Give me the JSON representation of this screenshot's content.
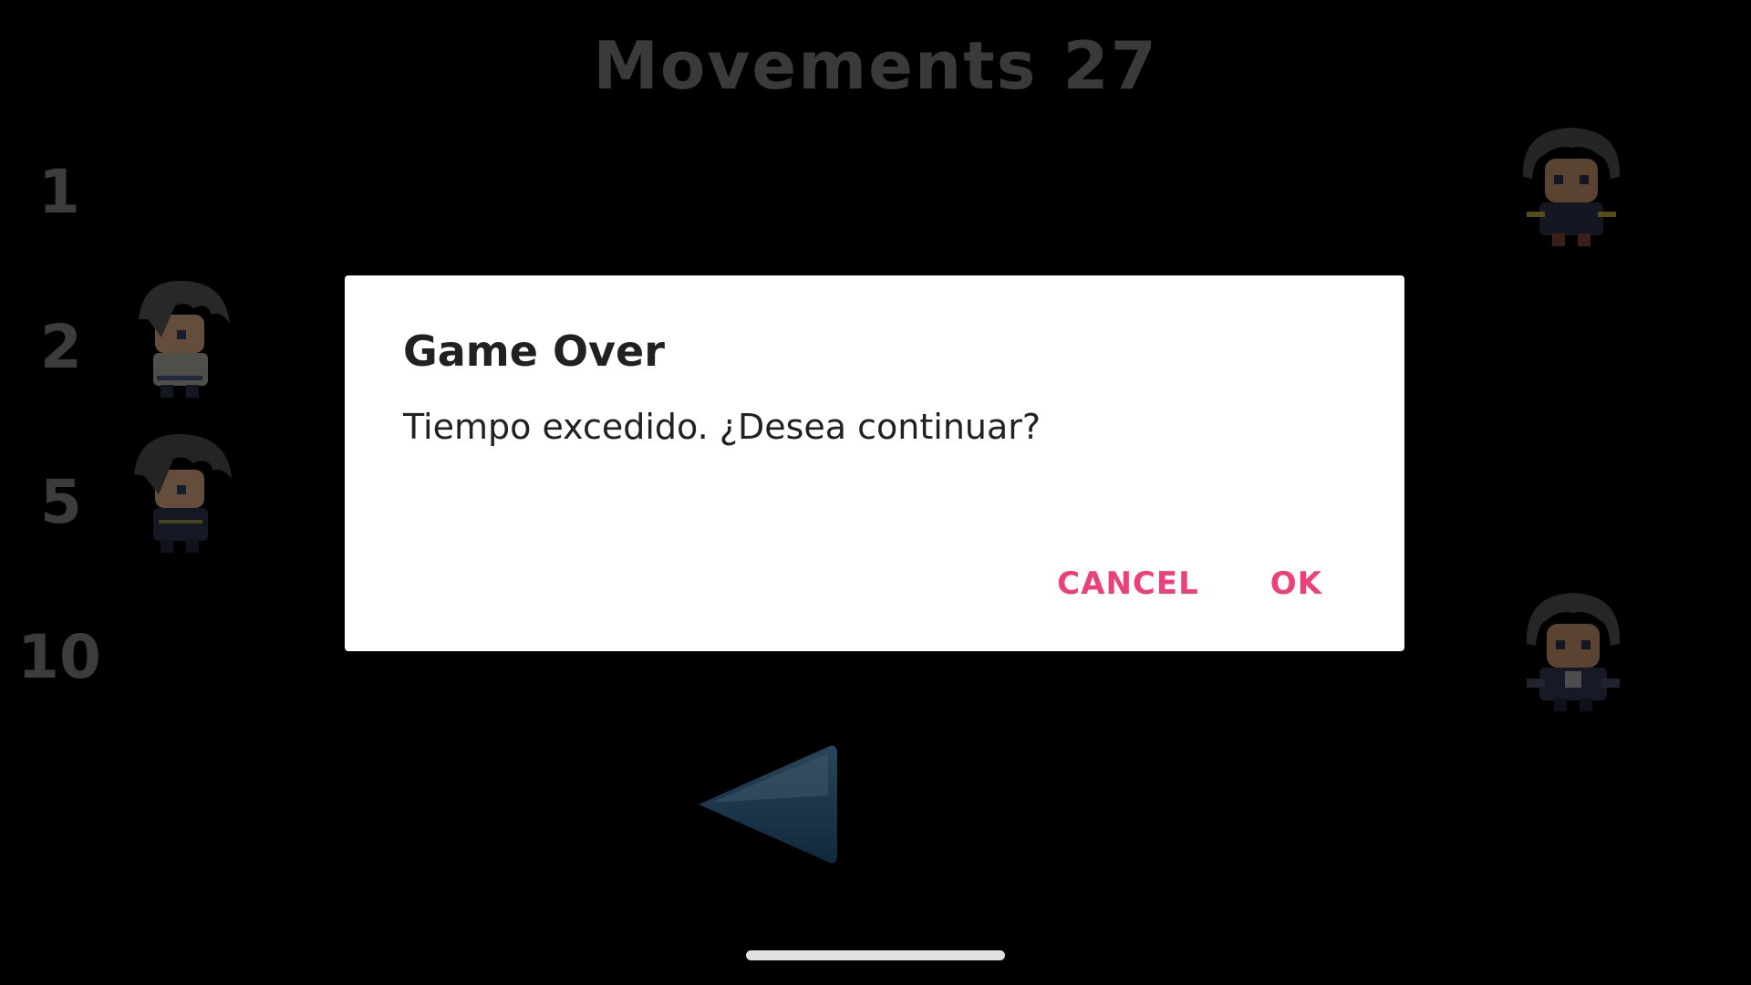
{
  "hud": {
    "label": "Movements",
    "count": "27"
  },
  "rows": [
    {
      "number": "1"
    },
    {
      "number": "2"
    },
    {
      "number": "5"
    },
    {
      "number": "10"
    }
  ],
  "characters": {
    "left": [
      "character-sprite",
      "character-sprite"
    ],
    "right": [
      "character-sprite",
      "character-sprite"
    ]
  },
  "controls": {
    "direction": "left"
  },
  "dialog": {
    "title": "Game Over",
    "message": "Tiempo excedido. ¿Desea continuar?",
    "cancel_label": "CANCEL",
    "ok_label": "OK",
    "accent_color": "#ec407a"
  }
}
